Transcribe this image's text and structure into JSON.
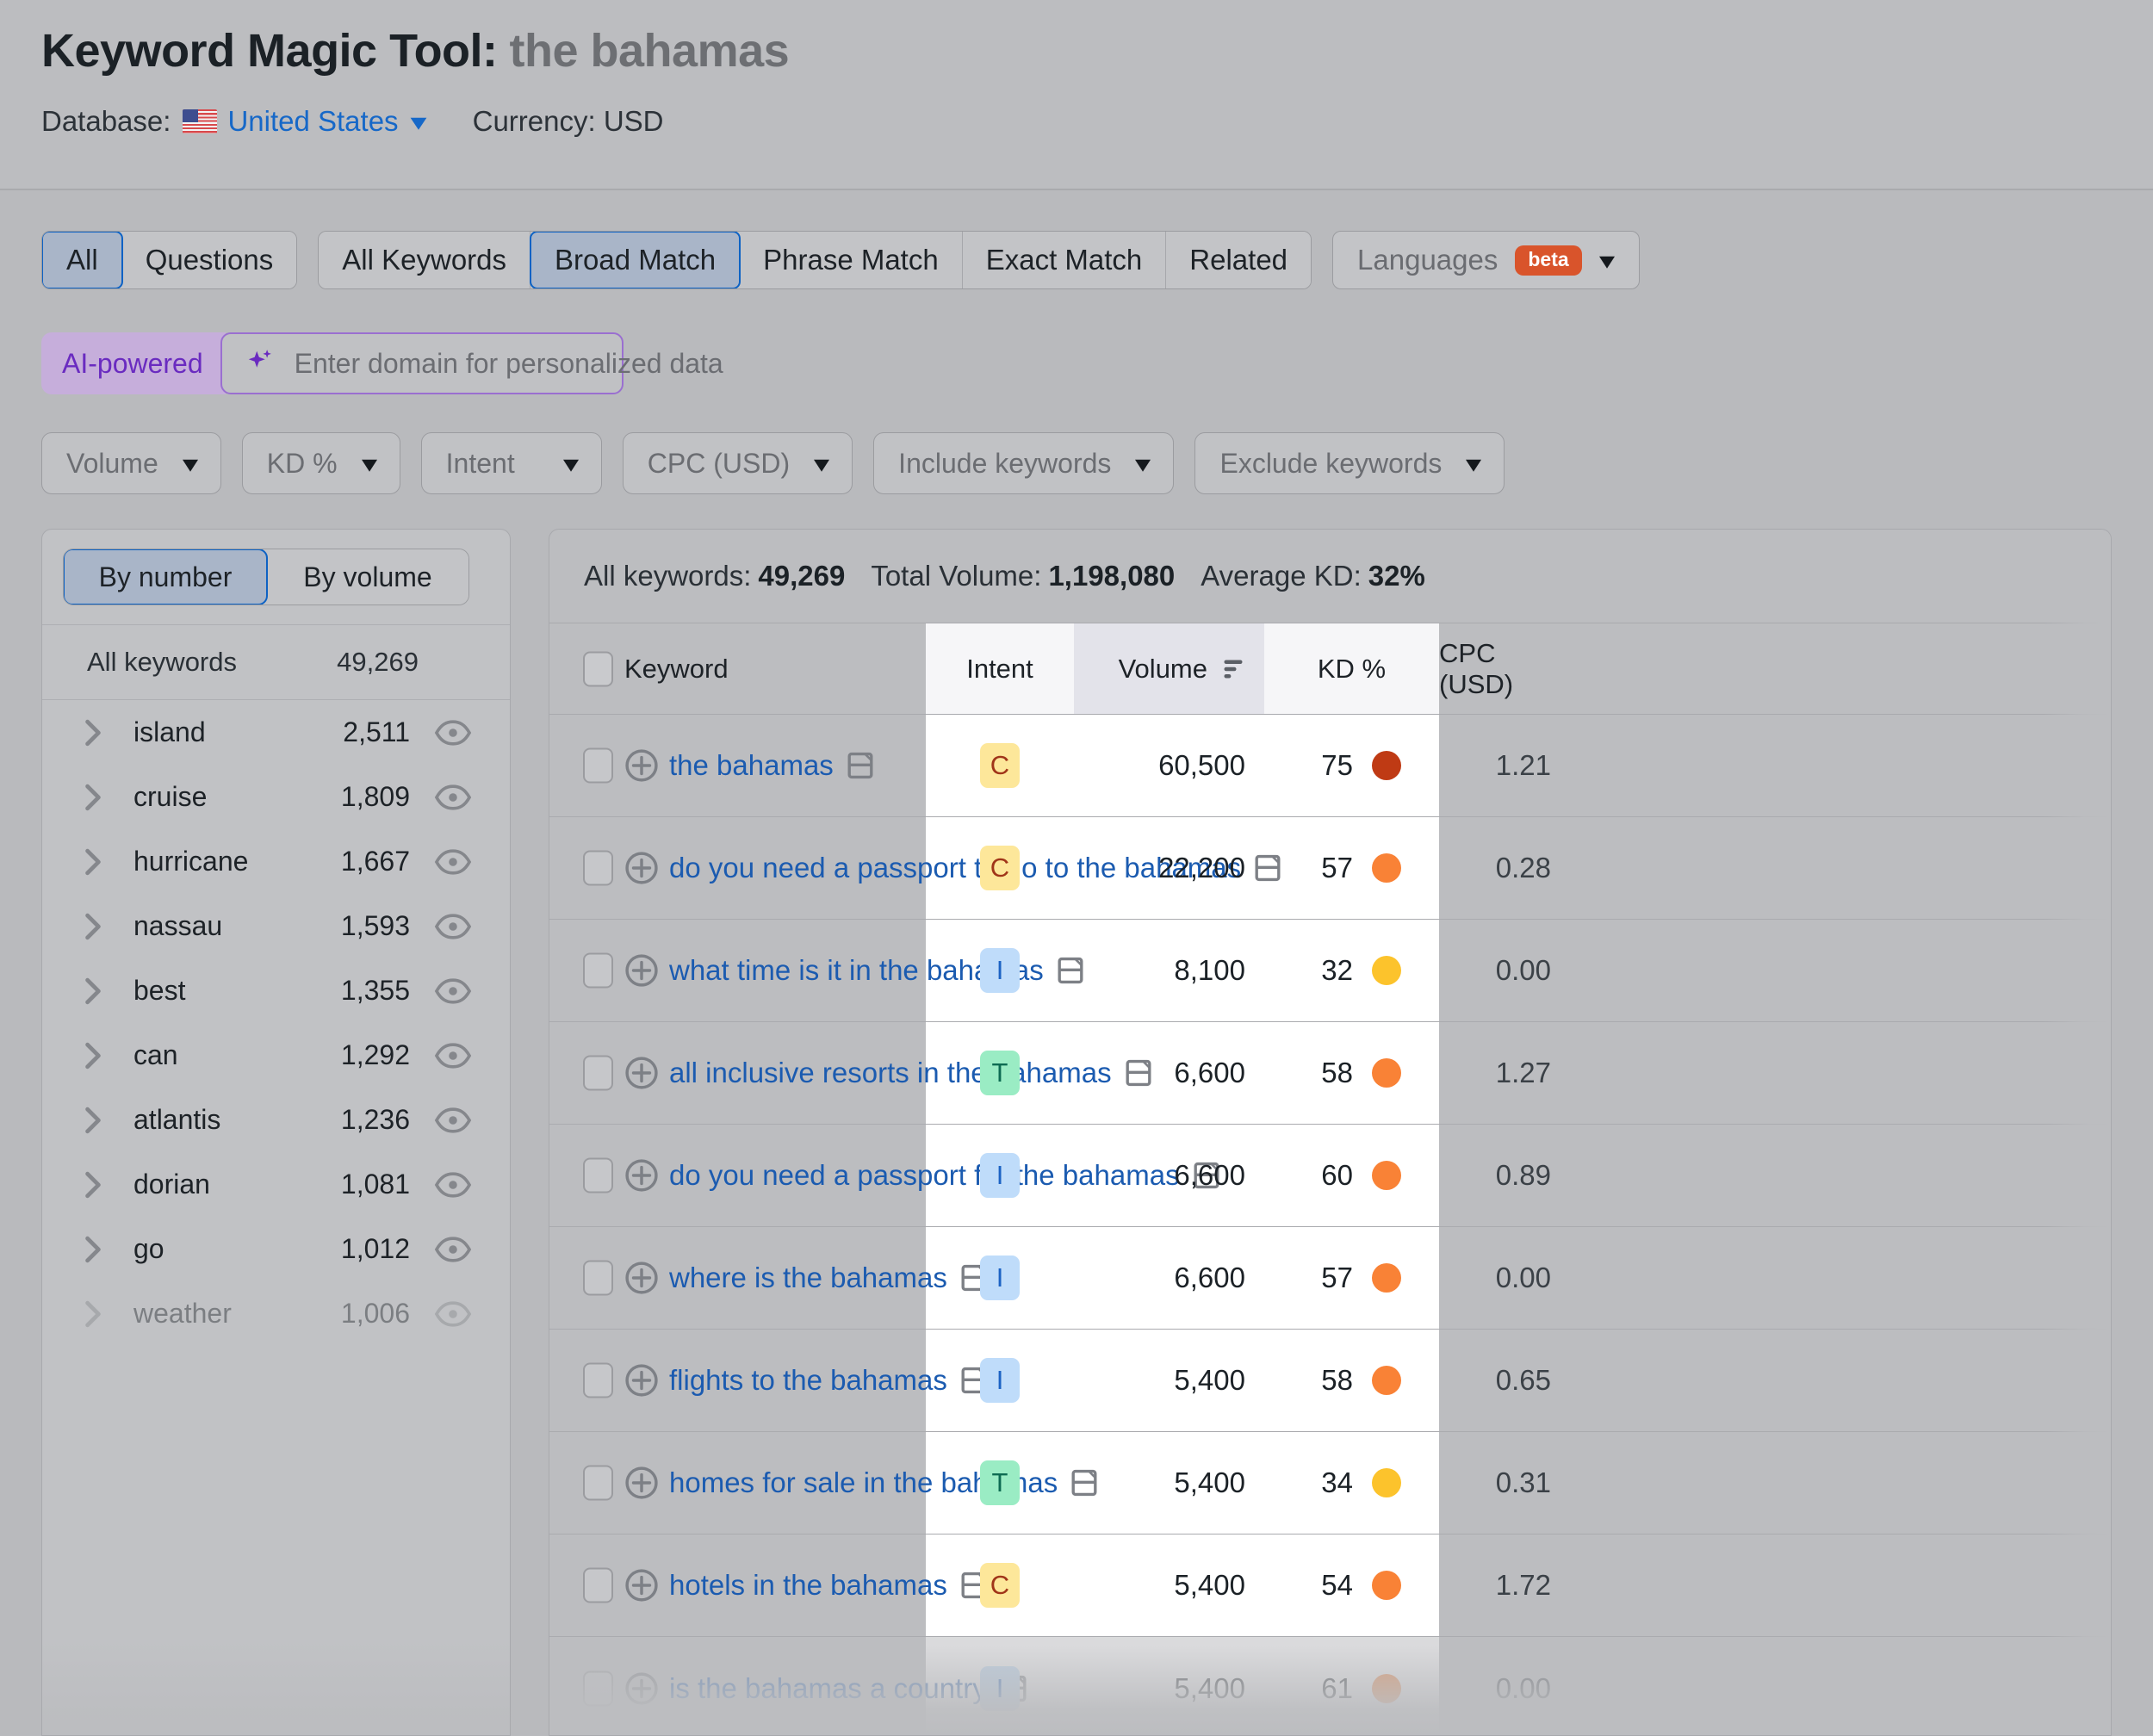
{
  "header": {
    "title_prefix": "Keyword Magic Tool:",
    "keyword": "the bahamas",
    "database_label": "Database:",
    "database_value": "United States",
    "currency_label": "Currency: USD",
    "flag_icon": "us-flag-icon"
  },
  "tabs": {
    "group1": [
      {
        "label": "All",
        "active": true
      },
      {
        "label": "Questions",
        "active": false
      }
    ],
    "group2": [
      {
        "label": "All Keywords",
        "active": false
      },
      {
        "label": "Broad Match",
        "active": true
      },
      {
        "label": "Phrase Match",
        "active": false
      },
      {
        "label": "Exact Match",
        "active": false
      },
      {
        "label": "Related",
        "active": false
      }
    ],
    "languages": {
      "label": "Languages",
      "badge": "beta"
    }
  },
  "ai_bar": {
    "badge": "AI-powered",
    "placeholder": "Enter domain for personalized data",
    "value": "",
    "icon": "sparkle-icon"
  },
  "filters": [
    {
      "label": "Volume"
    },
    {
      "label": "KD %"
    },
    {
      "label": "Intent"
    },
    {
      "label": "CPC (USD)"
    },
    {
      "label": "Include keywords"
    },
    {
      "label": "Exclude keywords"
    }
  ],
  "sidebar": {
    "toggle": [
      {
        "label": "By number",
        "active": true
      },
      {
        "label": "By volume",
        "active": false
      }
    ],
    "all_keywords_label": "All keywords",
    "all_keywords_count": "49,269",
    "groups": [
      {
        "label": "island",
        "count": "2,511"
      },
      {
        "label": "cruise",
        "count": "1,809"
      },
      {
        "label": "hurricane",
        "count": "1,667"
      },
      {
        "label": "nassau",
        "count": "1,593"
      },
      {
        "label": "best",
        "count": "1,355"
      },
      {
        "label": "can",
        "count": "1,292"
      },
      {
        "label": "atlantis",
        "count": "1,236"
      },
      {
        "label": "dorian",
        "count": "1,081"
      },
      {
        "label": "go",
        "count": "1,012"
      },
      {
        "label": "weather",
        "count": "1,006"
      }
    ]
  },
  "summary": {
    "all_keywords_label": "All keywords:",
    "all_keywords_value": "49,269",
    "total_volume_label": "Total Volume:",
    "total_volume_value": "1,198,080",
    "average_kd_label": "Average KD:",
    "average_kd_value": "32%"
  },
  "table": {
    "columns": {
      "keyword": "Keyword",
      "intent": "Intent",
      "volume": "Volume",
      "kd": "KD %",
      "cpc": "CPC (USD)"
    },
    "sorted_by": "volume",
    "rows": [
      {
        "keyword": "the bahamas",
        "intent": "C",
        "volume": "60,500",
        "kd": "75",
        "kd_color": "#bf3a14",
        "cpc": "1.21",
        "serp": "featured-snippet-icon"
      },
      {
        "keyword": "do you need a passport to go to the bahamas",
        "intent": "C",
        "volume": "22,200",
        "kd": "57",
        "kd_color": "#f98236",
        "cpc": "0.28",
        "serp": "featured-snippet-icon"
      },
      {
        "keyword": "what time is it in the bahamas",
        "intent": "I",
        "volume": "8,100",
        "kd": "32",
        "kd_color": "#fcc32c",
        "cpc": "0.00",
        "serp": "featured-snippet-icon"
      },
      {
        "keyword": "all inclusive resorts in the bahamas",
        "intent": "T",
        "volume": "6,600",
        "kd": "58",
        "kd_color": "#f98236",
        "cpc": "1.27",
        "serp": "featured-snippet-icon"
      },
      {
        "keyword": "do you need a passport for the bahamas",
        "intent": "I",
        "volume": "6,600",
        "kd": "60",
        "kd_color": "#f98236",
        "cpc": "0.89",
        "serp": "featured-snippet-icon"
      },
      {
        "keyword": "where is the bahamas",
        "intent": "I",
        "volume": "6,600",
        "kd": "57",
        "kd_color": "#f98236",
        "cpc": "0.00",
        "serp": "featured-snippet-icon"
      },
      {
        "keyword": "flights to the bahamas",
        "intent": "I",
        "volume": "5,400",
        "kd": "58",
        "kd_color": "#f98236",
        "cpc": "0.65",
        "serp": "featured-snippet-icon"
      },
      {
        "keyword": "homes for sale in the bahamas",
        "intent": "T",
        "volume": "5,400",
        "kd": "34",
        "kd_color": "#fcc32c",
        "cpc": "0.31",
        "serp": "featured-snippet-icon"
      },
      {
        "keyword": "hotels in the bahamas",
        "intent": "C",
        "volume": "5,400",
        "kd": "54",
        "kd_color": "#f98236",
        "cpc": "1.72",
        "serp": "featured-snippet-icon"
      },
      {
        "keyword": "is the bahamas a country",
        "intent": "I",
        "volume": "5,400",
        "kd": "61",
        "kd_color": "#f98236",
        "cpc": "0.00",
        "serp": "featured-snippet-icon"
      }
    ]
  }
}
